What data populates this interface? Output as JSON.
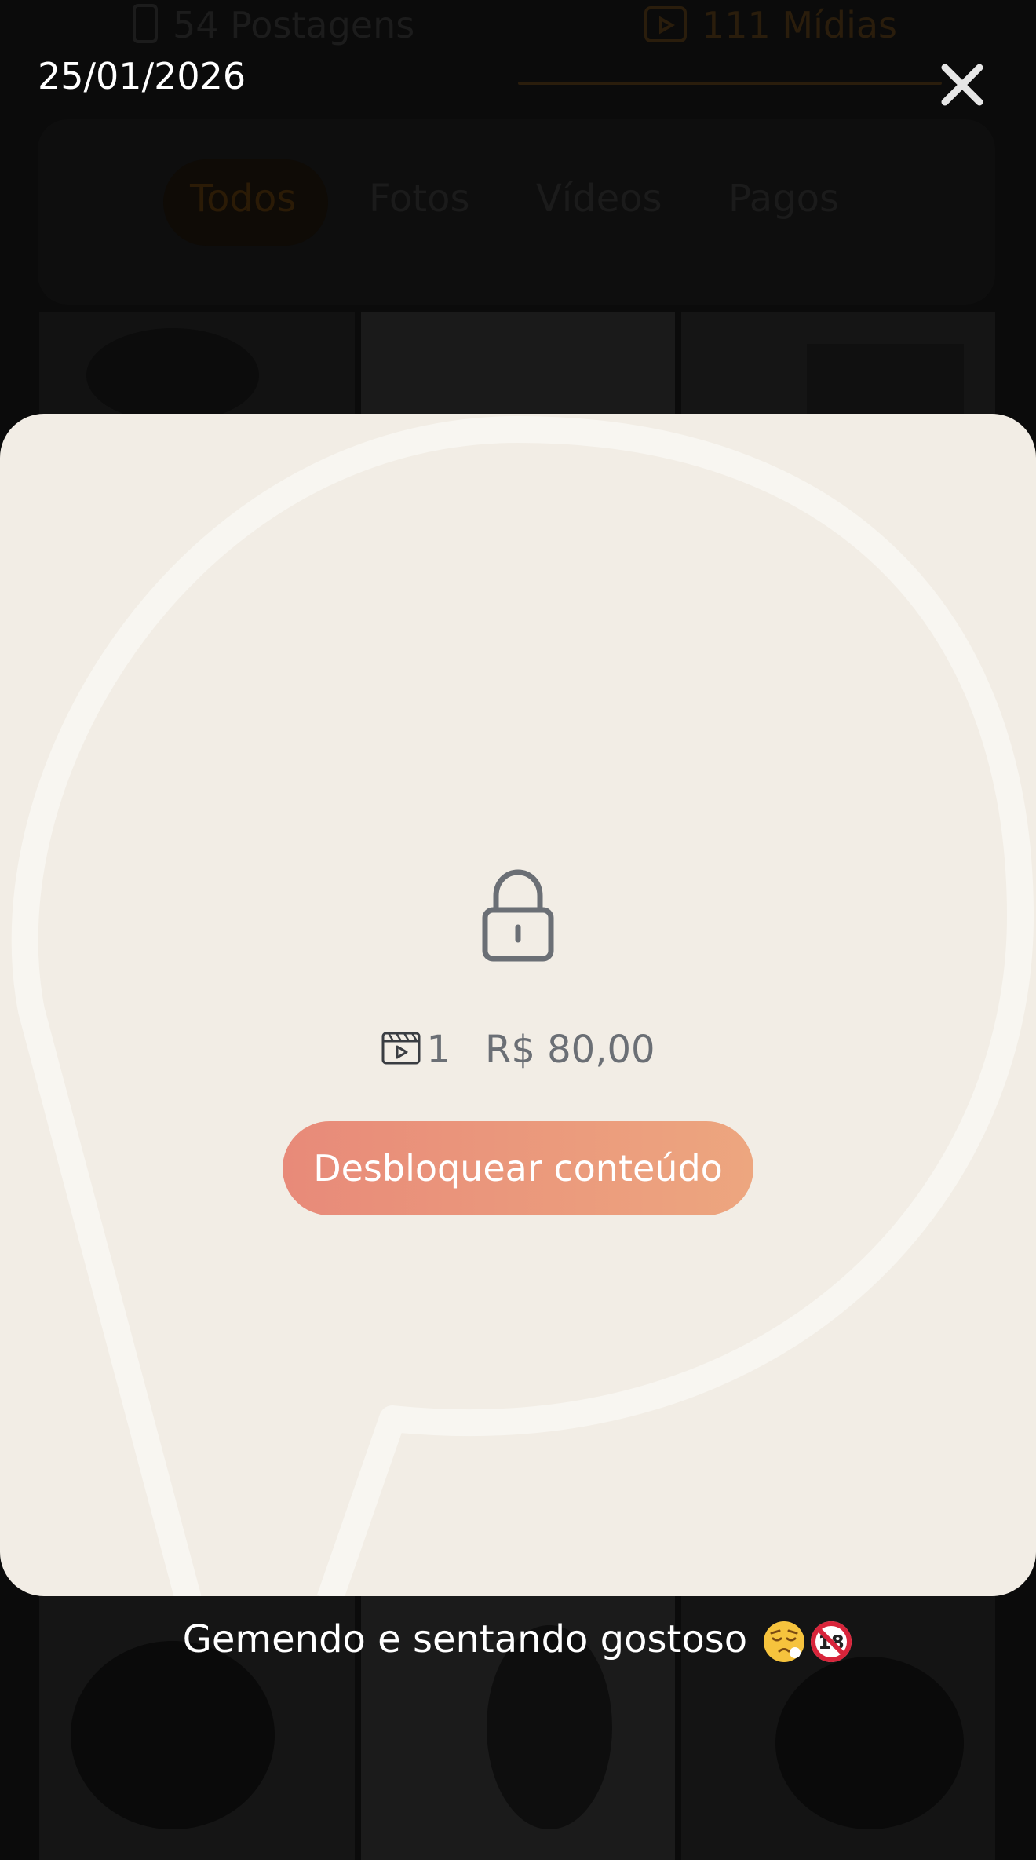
{
  "background": {
    "posts_count_label": "54 Postagens",
    "media_count_label": "111 Mídias",
    "filters": [
      "Todos",
      "Fotos",
      "Vídeos",
      "Pagos"
    ],
    "active_filter": "Todos"
  },
  "viewer": {
    "date": "25/01/2026",
    "close_icon": "close-icon"
  },
  "locked_content": {
    "lock_icon": "lock-icon",
    "media_icon": "video-clapper-icon",
    "media_count": "1",
    "price": "R$ 80,00",
    "unlock_label": "Desbloquear conteúdo"
  },
  "caption": {
    "text": "Gemendo e sentando gostoso",
    "emojis": [
      "sleepy-face-emoji",
      "no-under-18-emoji"
    ]
  },
  "colors": {
    "card_bg": "#f2ede5",
    "button_gradient_start": "#e88a79",
    "button_gradient_end": "#eda67f",
    "accent_orange": "#f29c38"
  }
}
